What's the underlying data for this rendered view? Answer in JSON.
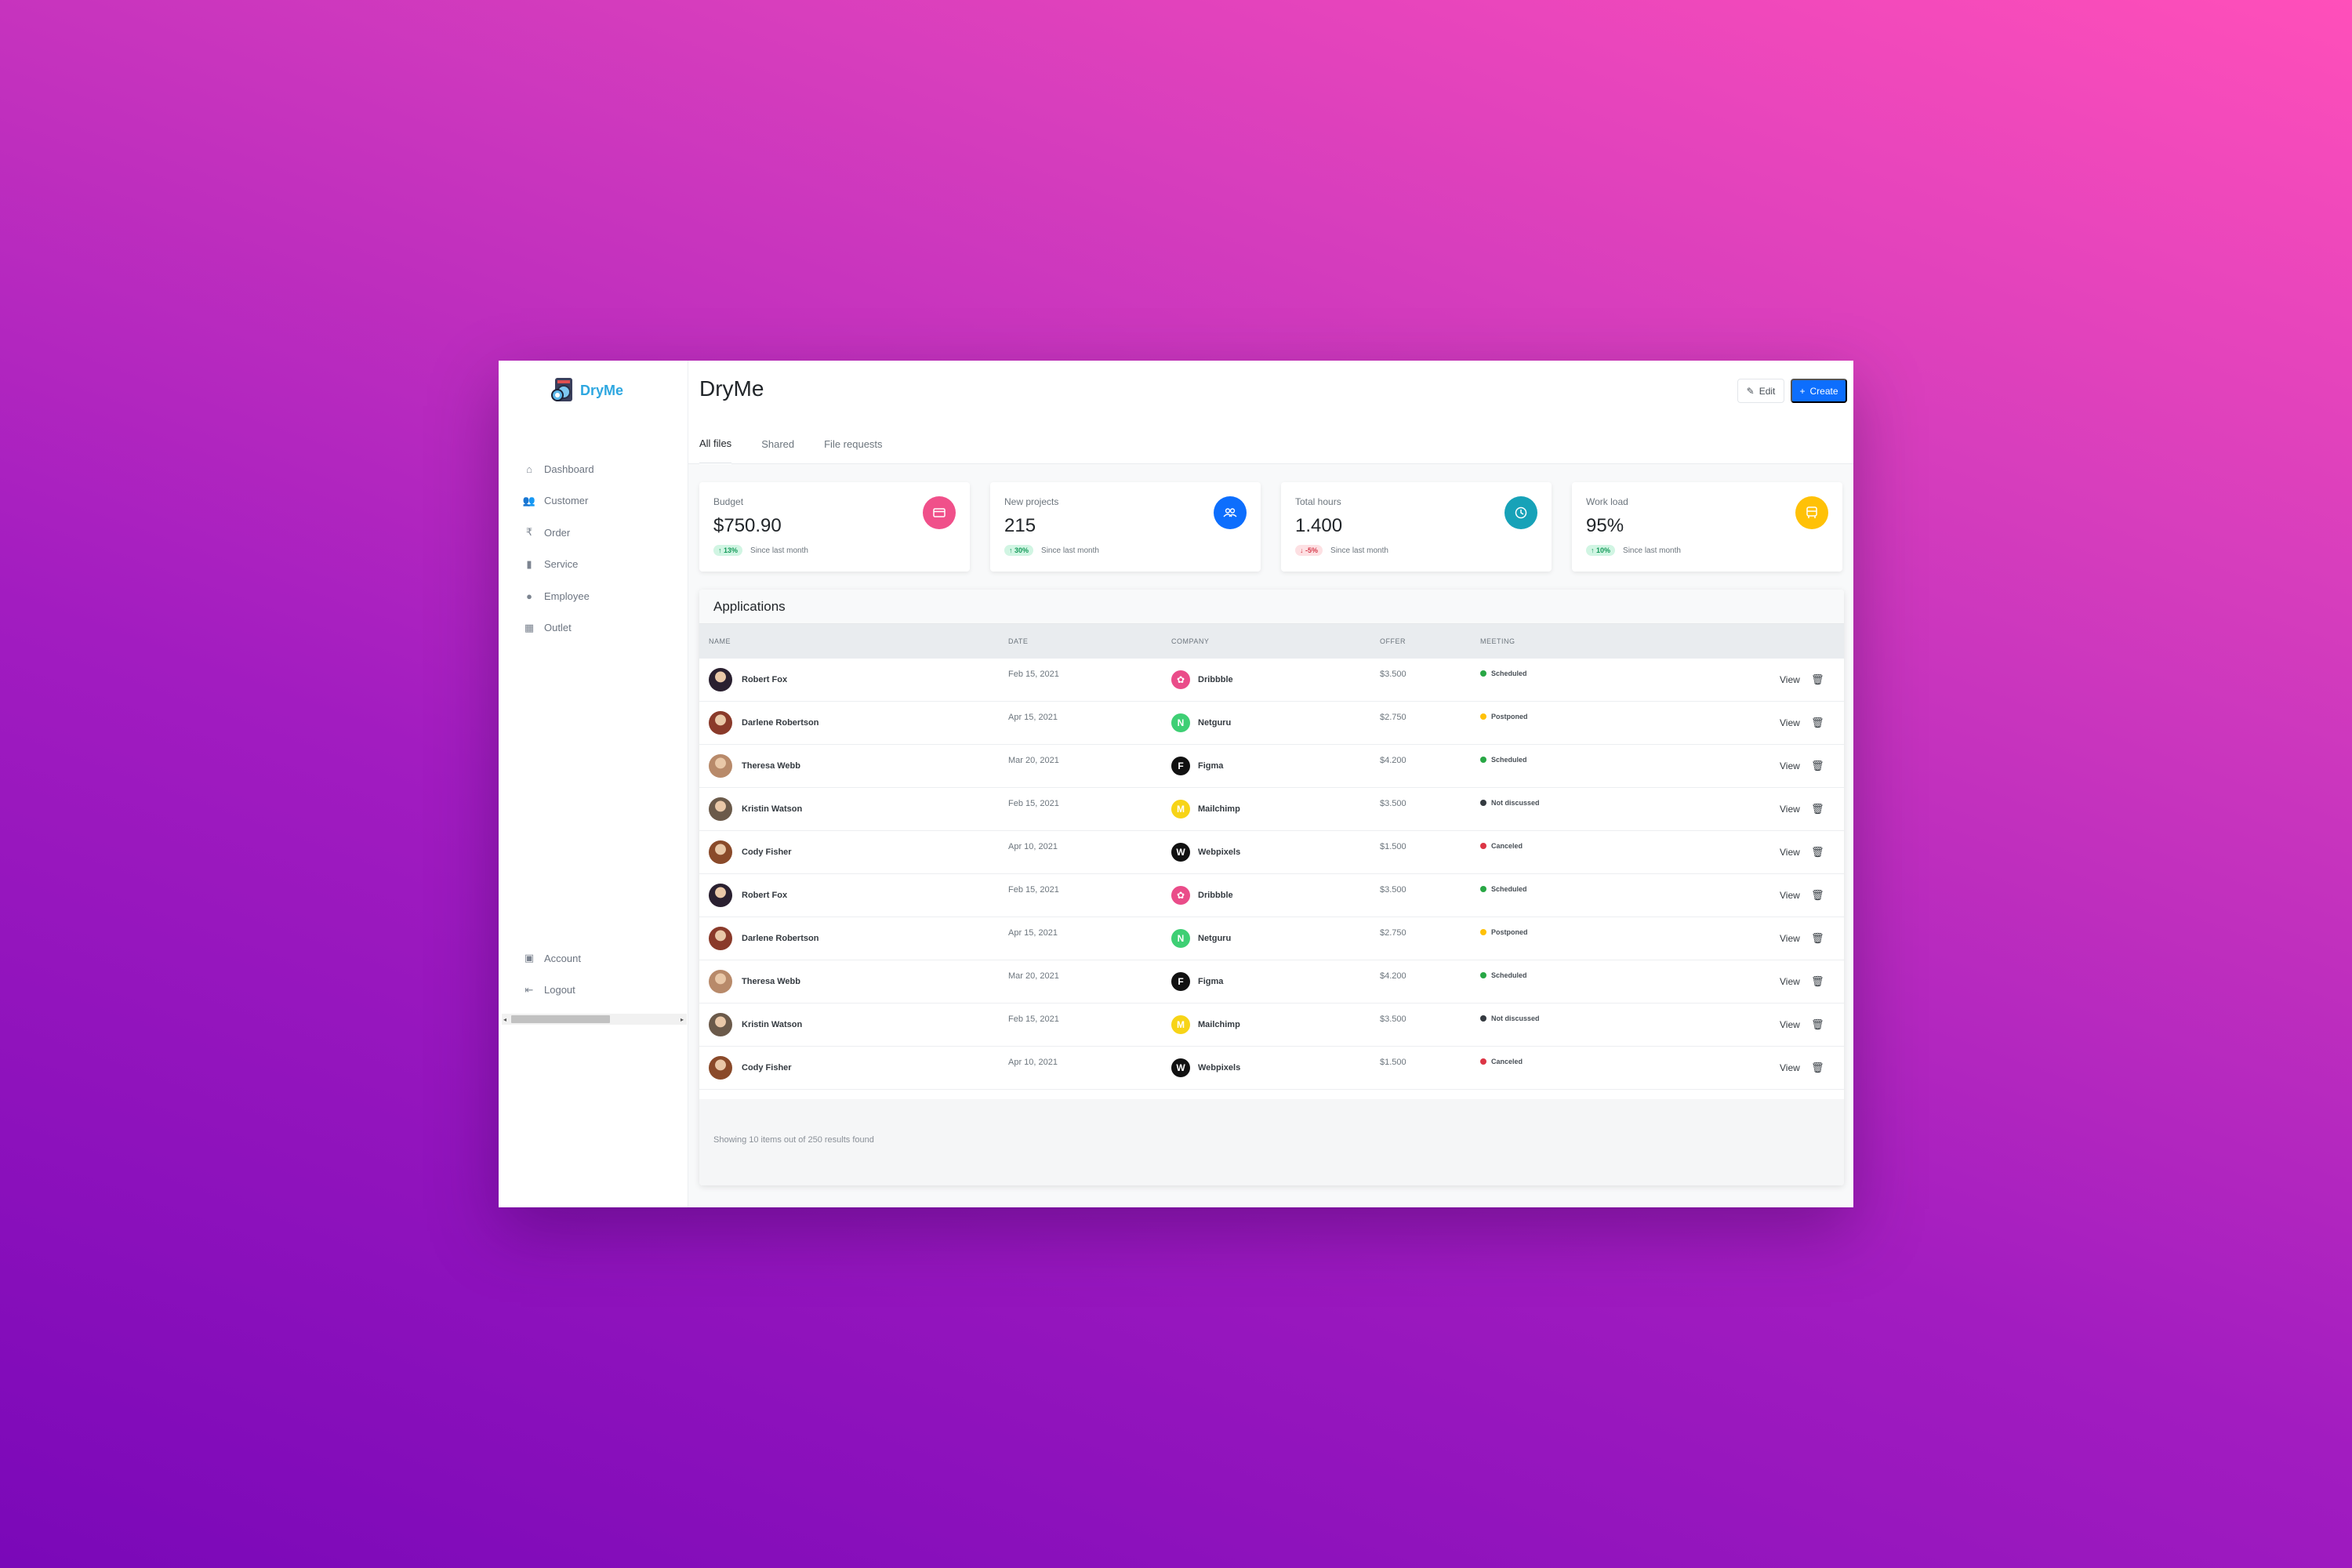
{
  "app": {
    "logo_text": "DryMe",
    "page_title": "DryMe"
  },
  "sidebar": {
    "items": [
      {
        "label": "Dashboard",
        "icon": "home-icon"
      },
      {
        "label": "Customer",
        "icon": "users-icon"
      },
      {
        "label": "Order",
        "icon": "rupee-icon"
      },
      {
        "label": "Service",
        "icon": "bag-icon"
      },
      {
        "label": "Employee",
        "icon": "person-icon"
      },
      {
        "label": "Outlet",
        "icon": "building-icon"
      }
    ],
    "bottom": [
      {
        "label": "Account",
        "icon": "account-icon"
      },
      {
        "label": "Logout",
        "icon": "logout-icon"
      }
    ]
  },
  "toolbar": {
    "edit_label": "Edit",
    "create_label": "Create"
  },
  "tabs": [
    {
      "label": "All files",
      "active": true
    },
    {
      "label": "Shared",
      "active": false
    },
    {
      "label": "File requests",
      "active": false
    }
  ],
  "cards": [
    {
      "label": "Budget",
      "value": "$750.90",
      "change": "13%",
      "direction": "up",
      "since": "Since last month",
      "icon": "card-icon",
      "color": "#f0508a"
    },
    {
      "label": "New projects",
      "value": "215",
      "change": "30%",
      "direction": "up",
      "since": "Since last month",
      "icon": "team-icon",
      "color": "#0d6efd"
    },
    {
      "label": "Total hours",
      "value": "1.400",
      "change": "-5%",
      "direction": "down",
      "since": "Since last month",
      "icon": "clock-icon",
      "color": "#17a2b8"
    },
    {
      "label": "Work load",
      "value": "95%",
      "change": "10%",
      "direction": "up",
      "since": "Since last month",
      "icon": "bus-icon",
      "color": "#ffc107"
    }
  ],
  "applications": {
    "title": "Applications",
    "columns": [
      "NAME",
      "DATE",
      "COMPANY",
      "OFFER",
      "MEETING"
    ],
    "rows": [
      {
        "name": "Robert Fox",
        "date": "Feb 15, 2021",
        "company": "Dribbble",
        "offer": "$3.500",
        "meeting": "Scheduled",
        "status_color": "#28a745",
        "logo_color": "#ea4c89",
        "logo": "✿",
        "avatar_color": "#2a2030"
      },
      {
        "name": "Darlene Robertson",
        "date": "Apr 15, 2021",
        "company": "Netguru",
        "offer": "$2.750",
        "meeting": "Postponed",
        "status_color": "#ffc107",
        "logo_color": "#3ecf74",
        "logo": "N",
        "avatar_color": "#8a3a2a"
      },
      {
        "name": "Theresa Webb",
        "date": "Mar 20, 2021",
        "company": "Figma",
        "offer": "$4.200",
        "meeting": "Scheduled",
        "status_color": "#28a745",
        "logo_color": "#111111",
        "logo": "F",
        "avatar_color": "#b88a6a"
      },
      {
        "name": "Kristin Watson",
        "date": "Feb 15, 2021",
        "company": "Mailchimp",
        "offer": "$3.500",
        "meeting": "Not discussed",
        "status_color": "#343a40",
        "logo_color": "#f7d417",
        "logo": "M",
        "avatar_color": "#6b5a4a"
      },
      {
        "name": "Cody Fisher",
        "date": "Apr 10, 2021",
        "company": "Webpixels",
        "offer": "$1.500",
        "meeting": "Canceled",
        "status_color": "#dc3545",
        "logo_color": "#111111",
        "logo": "W",
        "avatar_color": "#8a4a2a"
      },
      {
        "name": "Robert Fox",
        "date": "Feb 15, 2021",
        "company": "Dribbble",
        "offer": "$3.500",
        "meeting": "Scheduled",
        "status_color": "#28a745",
        "logo_color": "#ea4c89",
        "logo": "✿",
        "avatar_color": "#2a2030"
      },
      {
        "name": "Darlene Robertson",
        "date": "Apr 15, 2021",
        "company": "Netguru",
        "offer": "$2.750",
        "meeting": "Postponed",
        "status_color": "#ffc107",
        "logo_color": "#3ecf74",
        "logo": "N",
        "avatar_color": "#8a3a2a"
      },
      {
        "name": "Theresa Webb",
        "date": "Mar 20, 2021",
        "company": "Figma",
        "offer": "$4.200",
        "meeting": "Scheduled",
        "status_color": "#28a745",
        "logo_color": "#111111",
        "logo": "F",
        "avatar_color": "#b88a6a"
      },
      {
        "name": "Kristin Watson",
        "date": "Feb 15, 2021",
        "company": "Mailchimp",
        "offer": "$3.500",
        "meeting": "Not discussed",
        "status_color": "#343a40",
        "logo_color": "#f7d417",
        "logo": "M",
        "avatar_color": "#6b5a4a"
      },
      {
        "name": "Cody Fisher",
        "date": "Apr 10, 2021",
        "company": "Webpixels",
        "offer": "$1.500",
        "meeting": "Canceled",
        "status_color": "#dc3545",
        "logo_color": "#111111",
        "logo": "W",
        "avatar_color": "#8a4a2a"
      }
    ],
    "view_label": "View",
    "footer_text": "Showing 10 items out of 250 results found"
  }
}
